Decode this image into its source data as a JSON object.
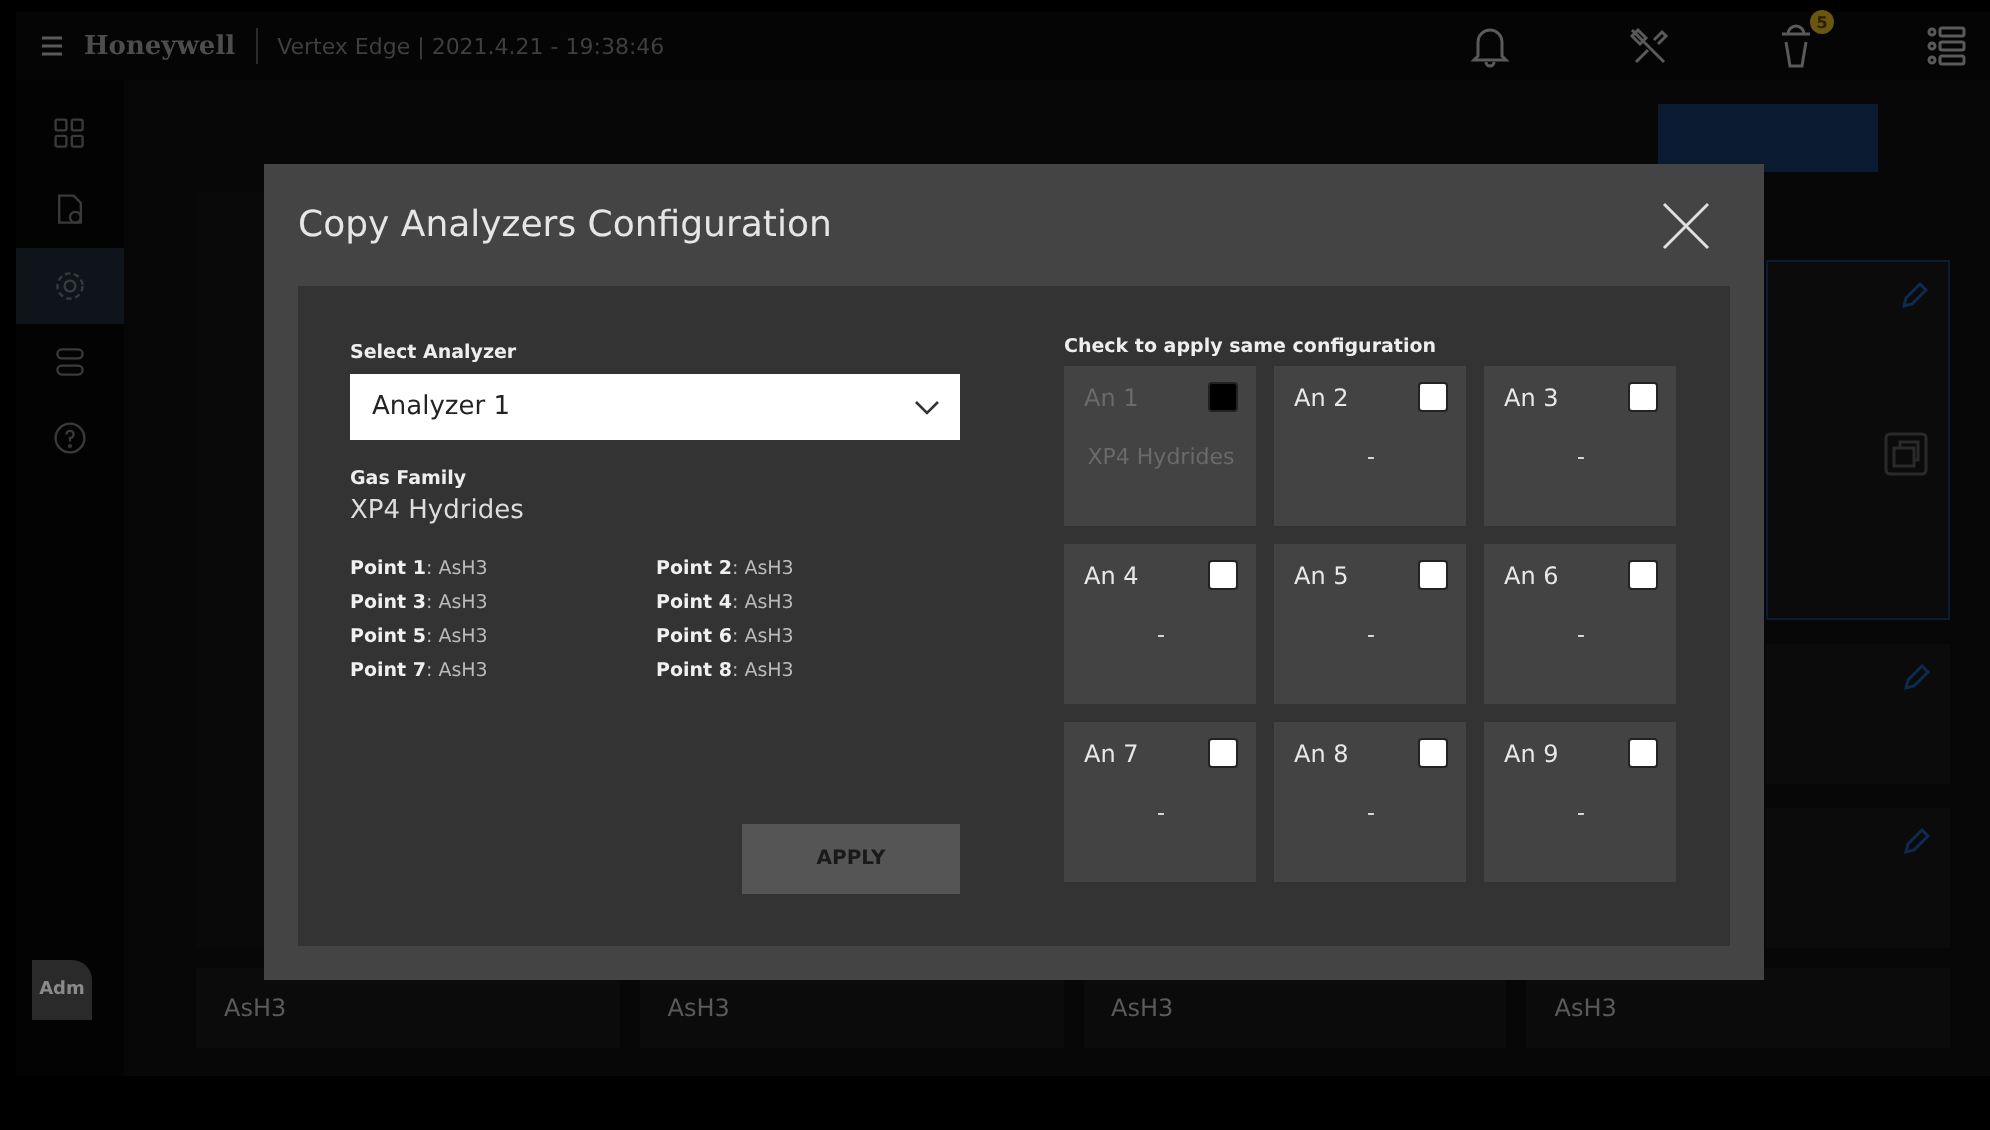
{
  "header": {
    "brand": "Honeywell",
    "title": "Vertex Edge | 2021.4.21 - 19:38:46",
    "badge": "5"
  },
  "sidebar": {
    "items": [
      {
        "kind": "grid",
        "selected": false
      },
      {
        "kind": "document",
        "selected": false
      },
      {
        "kind": "gear",
        "selected": true
      },
      {
        "kind": "toggles",
        "selected": false
      },
      {
        "kind": "help",
        "selected": false
      }
    ],
    "avatar": "Adm"
  },
  "background": {
    "bottom_values": [
      "AsH3",
      "AsH3",
      "AsH3",
      "AsH3"
    ]
  },
  "dialog": {
    "title": "Copy Analyzers Configuration",
    "select_label": "Select Analyzer",
    "select_value": "Analyzer 1",
    "gas_family_label": "Gas Family",
    "gas_family": "XP4 Hydrides",
    "points": [
      "**Point 1**: AsH3",
      "**Point 2**: AsH3",
      "**Point 3**: AsH3",
      "**Point 4**: AsH3",
      "**Point 5**: AsH3",
      "**Point 6**: AsH3",
      "**Point 7**: AsH3",
      "**Point 8**: AsH3"
    ],
    "apply": "APPLY",
    "check_label": "Check to apply same configuration",
    "analyzers": [
      {
        "name": "An 1",
        "value": "XP4 Hydrides",
        "checked": false,
        "disabled": true
      },
      {
        "name": "An 2",
        "value": "-",
        "checked": false,
        "disabled": false
      },
      {
        "name": "An 3",
        "value": "-",
        "checked": false,
        "disabled": false
      },
      {
        "name": "An 4",
        "value": "-",
        "checked": false,
        "disabled": false
      },
      {
        "name": "An 5",
        "value": "-",
        "checked": false,
        "disabled": false
      },
      {
        "name": "An 6",
        "value": "-",
        "checked": false,
        "disabled": false
      },
      {
        "name": "An 7",
        "value": "-",
        "checked": false,
        "disabled": false
      },
      {
        "name": "An 8",
        "value": "-",
        "checked": false,
        "disabled": false
      },
      {
        "name": "An 9",
        "value": "-",
        "checked": false,
        "disabled": false
      }
    ]
  }
}
